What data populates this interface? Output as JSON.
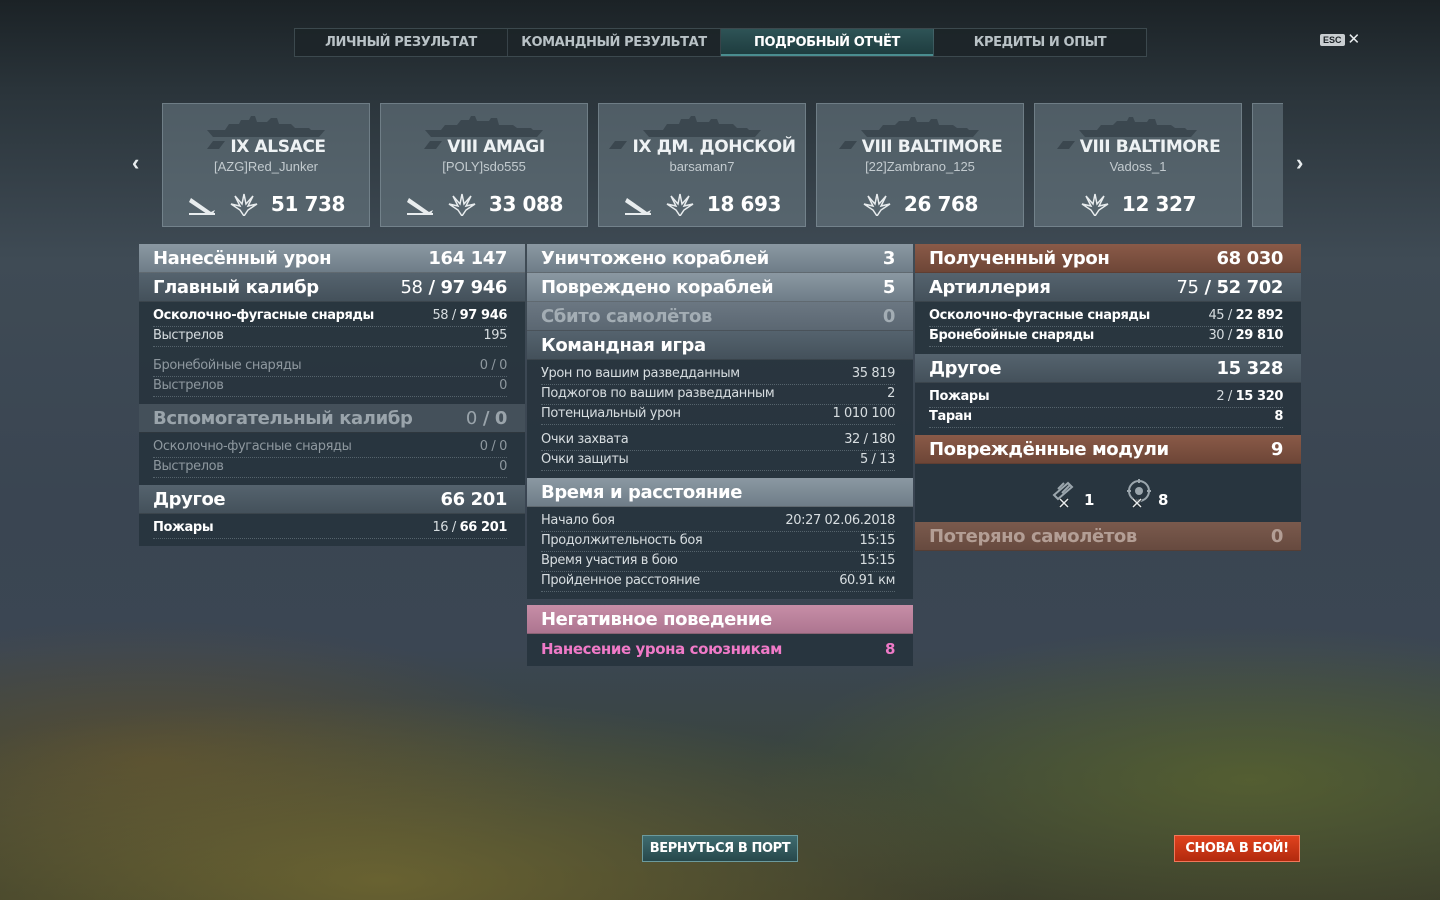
{
  "tabs": [
    {
      "label": "ЛИЧНЫЙ РЕЗУЛЬТАТ"
    },
    {
      "label": "КОМАНДНЫЙ РЕЗУЛЬТАТ"
    },
    {
      "label": "ПОДРОБНЫЙ ОТЧЁТ",
      "active": true
    },
    {
      "label": "КРЕДИТЫ И ОПЫТ"
    }
  ],
  "esc": {
    "key": "ESC",
    "close": "✕"
  },
  "nav": {
    "prev": "‹",
    "next": "›"
  },
  "cards": [
    {
      "tier": "IX",
      "name": "ALSACE",
      "player": "[AZG]Red_Junker",
      "damage": "51 738",
      "has_torpedo_icon": true
    },
    {
      "tier": "VIII",
      "name": "AMAGI",
      "player": "[POLY]sdo555",
      "damage": "33 088",
      "has_torpedo_icon": true
    },
    {
      "tier": "IX",
      "name": "ДМ. ДОНСКОЙ",
      "player": "barsaman7",
      "damage": "18 693",
      "has_torpedo_icon": true
    },
    {
      "tier": "VIII",
      "name": "BALTIMORE",
      "player": "[22]Zambrano_125",
      "damage": "26 768",
      "has_torpedo_icon": false
    },
    {
      "tier": "VIII",
      "name": "BALTIMORE",
      "player": "Vadoss_1",
      "damage": "12 327",
      "has_torpedo_icon": false
    }
  ],
  "dealt": {
    "title": "Нанесённый урон",
    "total": "164 147",
    "main_caliber": {
      "label": "Главный калибр",
      "hits": "58",
      "damage": "97 946"
    },
    "main_rows": [
      {
        "label": "Осколочно-фугасные снаряды",
        "hits": "58",
        "damage": "97 946"
      },
      {
        "label": "Выстрелов",
        "value": "195"
      },
      {
        "label": "Бронебойные снаряды",
        "hits": "0",
        "damage": "0"
      },
      {
        "label": "Выстрелов",
        "value": "0"
      }
    ],
    "secondary": {
      "label": "Вспомогательный калибр",
      "hits": "0",
      "damage": "0"
    },
    "secondary_rows": [
      {
        "label": "Осколочно-фугасные снаряды",
        "hits": "0",
        "damage": "0"
      },
      {
        "label": "Выстрелов",
        "value": "0"
      }
    ],
    "other": {
      "label": "Другое",
      "value": "66 201"
    },
    "other_rows": [
      {
        "label": "Пожары",
        "hits": "16",
        "damage": "66 201"
      }
    ]
  },
  "middle": {
    "destroyed": {
      "label": "Уничтожено кораблей",
      "value": "3"
    },
    "damaged": {
      "label": "Повреждено кораблей",
      "value": "5"
    },
    "planes": {
      "label": "Сбито самолётов",
      "value": "0"
    },
    "team_play": {
      "label": "Командная игра",
      "rows": [
        {
          "label": "Урон по вашим разведданным",
          "value": "35 819"
        },
        {
          "label": "Поджогов по вашим разведданным",
          "value": "2"
        },
        {
          "label": "Потенциальный урон",
          "value": "1 010 100"
        },
        {
          "label": "Очки захвата",
          "value": "32 / 180"
        },
        {
          "label": "Очки защиты",
          "value": "5 / 13"
        }
      ]
    },
    "time": {
      "label": "Время и расстояние",
      "rows": [
        {
          "label": "Начало боя",
          "value": "20:27  02.06.2018"
        },
        {
          "label": "Продолжительность боя",
          "value": "15:15"
        },
        {
          "label": "Время участия в бою",
          "value": "15:15"
        },
        {
          "label": "Пройденное расстояние",
          "value": "60.91 км"
        }
      ]
    },
    "negative": {
      "label": "Негативное поведение",
      "rows": [
        {
          "label": "Нанесение урона союзникам",
          "value": "8"
        }
      ]
    }
  },
  "received": {
    "title": "Полученный урон",
    "total": "68 030",
    "artillery": {
      "label": "Артиллерия",
      "hits": "75",
      "damage": "52 702"
    },
    "artillery_rows": [
      {
        "label": "Осколочно-фугасные снаряды",
        "hits": "45",
        "damage": "22 892"
      },
      {
        "label": "Бронебойные снаряды",
        "hits": "30",
        "damage": "29 810"
      }
    ],
    "other": {
      "label": "Другое",
      "value": "15 328"
    },
    "other_rows": [
      {
        "label": "Пожары",
        "hits": "2",
        "damage": "15 320"
      },
      {
        "label": "Таран",
        "value": "8"
      }
    ],
    "modules": {
      "label": "Повреждённые модули",
      "value": "9",
      "items": [
        {
          "icon": "gun-turret-icon",
          "count": "1"
        },
        {
          "icon": "engine-icon",
          "count": "8"
        }
      ]
    },
    "planes_lost": {
      "label": "Потеряно самолётов",
      "value": "0"
    }
  },
  "buttons": {
    "port": "ВЕРНУТЬСЯ В ПОРТ",
    "battle": "СНОВА В БОЙ!"
  },
  "colors": {
    "tab_active": "#2e5356",
    "header_light": "#8b98a2",
    "header_brown": "#8a5a48",
    "header_pink": "#c78ea7",
    "negative_text": "#f07ac8",
    "battle_button": "#e0421e",
    "port_button": "#3f6c70"
  }
}
